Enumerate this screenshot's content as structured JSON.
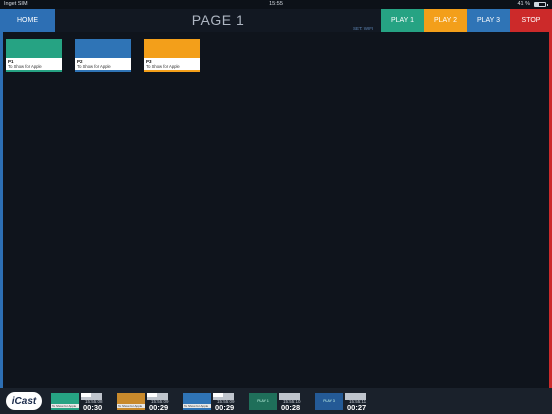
{
  "status": {
    "carrier": "Inget SIM",
    "time": "15:55",
    "battery": "41 %",
    "battery_level": 0.41
  },
  "header": {
    "home_label": "HOME",
    "page_title": "PAGE 1",
    "set_info": "SET: WIFI",
    "play1_label": "PLAY 1",
    "play2_label": "PLAY 2",
    "play3_label": "PLAY 3",
    "stop_label": "STOP"
  },
  "colors": {
    "teal": "#26a383",
    "orange": "#f39f1a",
    "blue": "#2f74b6",
    "red": "#cc2a2a",
    "home": "#2d6fb4"
  },
  "tiles": [
    {
      "id": "P1",
      "subtitle": "To Show for Apple",
      "color": "#26a383"
    },
    {
      "id": "P2",
      "subtitle": "To Show for Apple",
      "color": "#2f74b6"
    },
    {
      "id": "P3",
      "subtitle": "To Show for Apple",
      "color": "#f39f1a"
    }
  ],
  "footer": {
    "logo": "iCast",
    "channels": [
      {
        "thumb_color": "#26a383",
        "thumb_label": "To Show for Apple",
        "time_small": "15:55:08",
        "time_big": "00:30"
      },
      {
        "thumb_color": "#c98a2c",
        "thumb_label": "To Show for Apple",
        "time_small": "15:55:09",
        "time_big": "00:29"
      },
      {
        "thumb_color": "#2f74b6",
        "thumb_label": "To Show for Apple",
        "time_small": "15:55:09",
        "time_big": "00:29"
      },
      {
        "thumb_color": "#1f6f5a",
        "thumb_text": "PLAY 1",
        "time_small": "15:55:10",
        "time_big": "00:28"
      },
      {
        "thumb_color": "#245a96",
        "thumb_text": "PLAY 3",
        "time_small": "15:55:11",
        "time_big": "00:27"
      }
    ]
  }
}
